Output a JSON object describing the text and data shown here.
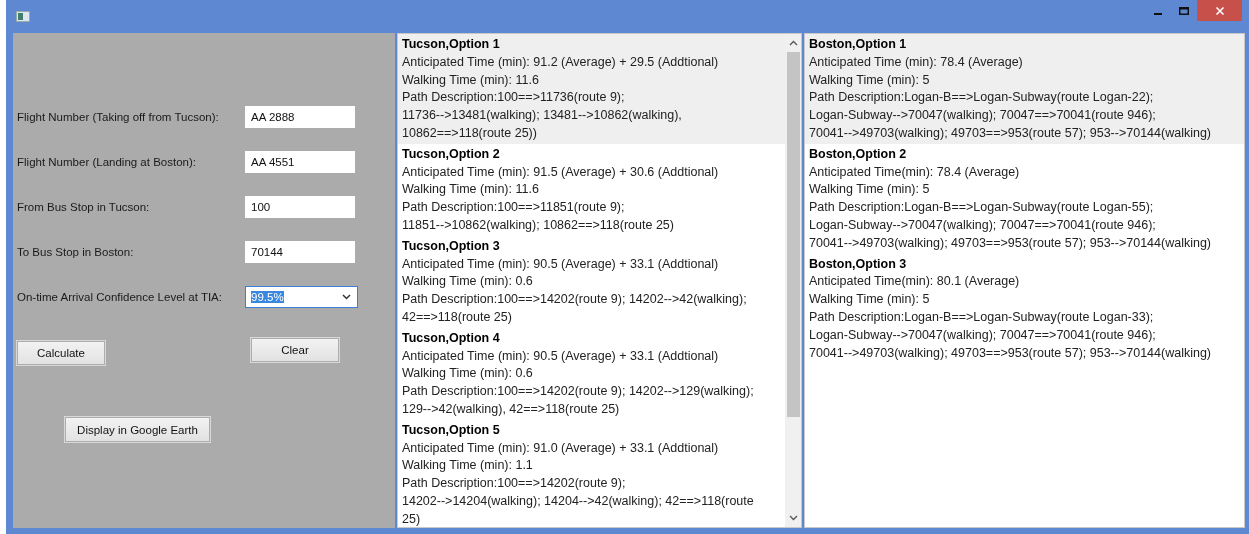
{
  "form": {
    "fields": [
      {
        "kind": "text",
        "label": "Flight Number (Taking off from Tucson):",
        "value": "AA 2888"
      },
      {
        "kind": "text",
        "label": "Flight Number (Landing at Boston):",
        "value": "AA 4551"
      },
      {
        "kind": "text",
        "label": "From Bus Stop in Tucson:",
        "value": "100"
      },
      {
        "kind": "text",
        "label": "To Bus Stop in Boston:",
        "value": "70144"
      },
      {
        "kind": "dropdown",
        "label": "On-time Arrival Confidence Level at TIA:",
        "value": "99.5%",
        "highlighted": true
      }
    ],
    "buttons": [
      "Calculate",
      "Clear",
      "Display in Google Earth"
    ]
  },
  "tucson_list": {
    "items": [
      {
        "title": "Tucson,Option 1",
        "selected": true,
        "lines": [
          "Anticipated Time (min): 91.2 (Average) + 29.5 (Addtional)",
          "Walking Time (min): 11.6",
          "Path Description:100==>11736(route 9);",
          "11736-->13481(walking); 13481-->10862(walking),",
          "10862==>118(route 25))"
        ]
      },
      {
        "title": "Tucson,Option 2",
        "selected": false,
        "lines": [
          "Anticipated Time (min): 91.5 (Average) + 30.6 (Addtional)",
          "Walking Time (min): 11.6",
          "Path Description:100==>11851(route 9);",
          "11851-->10862(walking); 10862==>118(route 25)"
        ]
      },
      {
        "title": "Tucson,Option 3",
        "selected": false,
        "lines": [
          "Anticipated Time (min): 90.5 (Average) + 33.1 (Addtional)",
          "Walking Time (min): 0.6",
          "Path Description:100==>14202(route 9); 14202-->42(walking);",
          "42==>118(route 25)"
        ]
      },
      {
        "title": "Tucson,Option 4",
        "selected": false,
        "lines": [
          "Anticipated Time (min): 90.5 (Average) + 33.1 (Addtional)",
          "Walking Time (min): 0.6",
          "Path Description:100==>14202(route 9); 14202-->129(walking);",
          "129-->42(walking), 42==>118(route 25)"
        ]
      },
      {
        "title": "Tucson,Option 5",
        "selected": false,
        "lines": [
          "Anticipated Time (min): 91.0 (Average) + 33.1 (Addtional)",
          "Walking Time (min): 1.1",
          "Path Description:100==>14202(route 9);",
          "14202-->14204(walking); 14204-->42(walking); 42==>118(route",
          "25)"
        ]
      }
    ]
  },
  "boston_list": {
    "items": [
      {
        "title": "Boston,Option 1",
        "selected": true,
        "lines": [
          "Anticipated Time (min): 78.4 (Average)",
          "Walking Time (min): 5",
          "Path Description:Logan-B==>Logan-Subway(route Logan-22);",
          "Logan-Subway-->70047(walking); 70047==>70041(route 946);",
          "70041-->49703(walking); 49703==>953(route 57); 953-->70144(walking)"
        ]
      },
      {
        "title": "Boston,Option 2",
        "selected": false,
        "lines": [
          "Anticipated Time(min): 78.4 (Average)",
          "Walking Time (min): 5",
          "Path Description:Logan-B==>Logan-Subway(route Logan-55);",
          "Logan-Subway-->70047(walking); 70047==>70041(route 946);",
          "70041-->49703(walking); 49703==>953(route 57); 953-->70144(walking)"
        ]
      },
      {
        "title": "Boston,Option 3",
        "selected": false,
        "lines": [
          "Anticipated Time(min): 80.1 (Average)",
          "Walking Time (min): 5",
          "Path Description:Logan-B==>Logan-Subway(route Logan-33);",
          "Logan-Subway-->70047(walking); 70047==>70041(route 946);",
          "70041-->49703(walking); 49703==>953(route 57); 953-->70144(walking)"
        ]
      }
    ]
  }
}
